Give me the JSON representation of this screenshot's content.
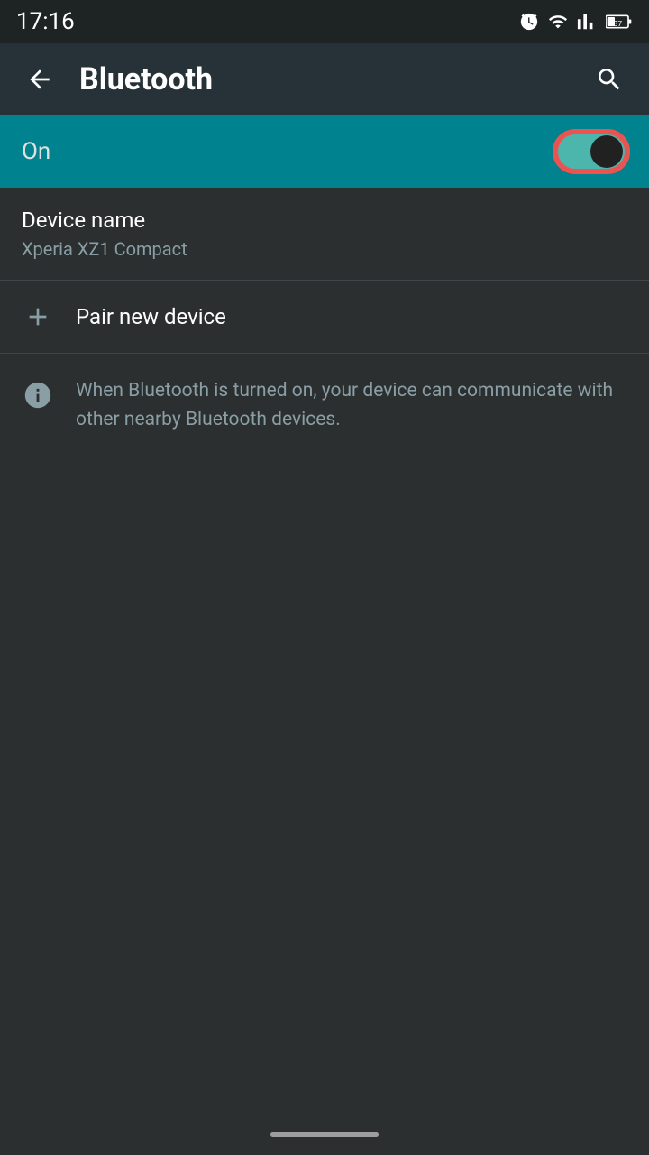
{
  "statusBar": {
    "time": "17:16",
    "batteryLevel": "37"
  },
  "appBar": {
    "title": "Bluetooth",
    "backLabel": "back",
    "searchLabel": "search"
  },
  "toggleRow": {
    "label": "On",
    "state": true
  },
  "deviceName": {
    "title": "Device name",
    "subtitle": "Xperia XZ1 Compact"
  },
  "pairNewDevice": {
    "label": "Pair new device"
  },
  "infoMessage": {
    "text": "When Bluetooth is turned on, your device can communicate with other nearby Bluetooth devices."
  }
}
